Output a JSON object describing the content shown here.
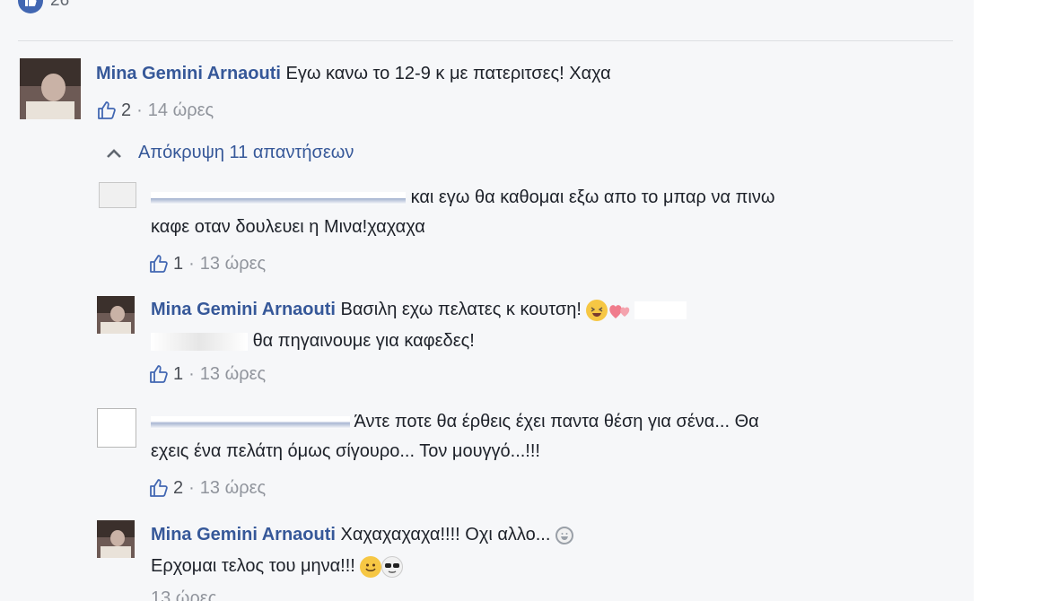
{
  "reactions": {
    "count": "26"
  },
  "comment": {
    "author": "Mina Gemini Arnaouti",
    "text": "Εγω κανω το 12-9 κ με πατεριτσες! Χαχα",
    "likes": "2",
    "time": "14 ώρες"
  },
  "replies_toggle": "Απόκρυψη 11 απαντήσεων",
  "replies": [
    {
      "text_line1": "και εγω θα καθομαι εξω απο το μπαρ να πινω",
      "text_line2": "καφε οταν δουλευει η Μινα!χαχαχα",
      "likes": "1",
      "time": "13 ώρες"
    },
    {
      "author": "Mina Gemini Arnaouti",
      "text_line1": "Βασιλη εχω πελατες κ κουτση!",
      "text_line2": "θα πηγαινουμε για καφεδες!",
      "likes": "1",
      "time": "13 ώρες"
    },
    {
      "text_line1": "Άντε ποτε θα έρθεις έχει παντα θέση για σένα... Θα",
      "text_line2": "εχεις ένα πελάτη όμως σίγουρο... Τον μουγγό...!!!",
      "likes": "2",
      "time": "13 ώρες"
    },
    {
      "author": "Mina Gemini Arnaouti",
      "text_line1": "Χαχαχαχαχα!!!! Οχι αλλο...",
      "text_line2": "Ερχομαι τελος του μηνα!!!",
      "time": "13 ώρες"
    }
  ],
  "colors": {
    "link": "#365899",
    "meta": "#90949c",
    "text": "#1d2129",
    "background": "#f6f7f9"
  },
  "icons": [
    "like-badge-icon",
    "thumbs-up-icon",
    "chevron-up-icon",
    "laughing-emoji",
    "hearts-emoji",
    "smile-emoji",
    "sunglasses-emoji"
  ]
}
